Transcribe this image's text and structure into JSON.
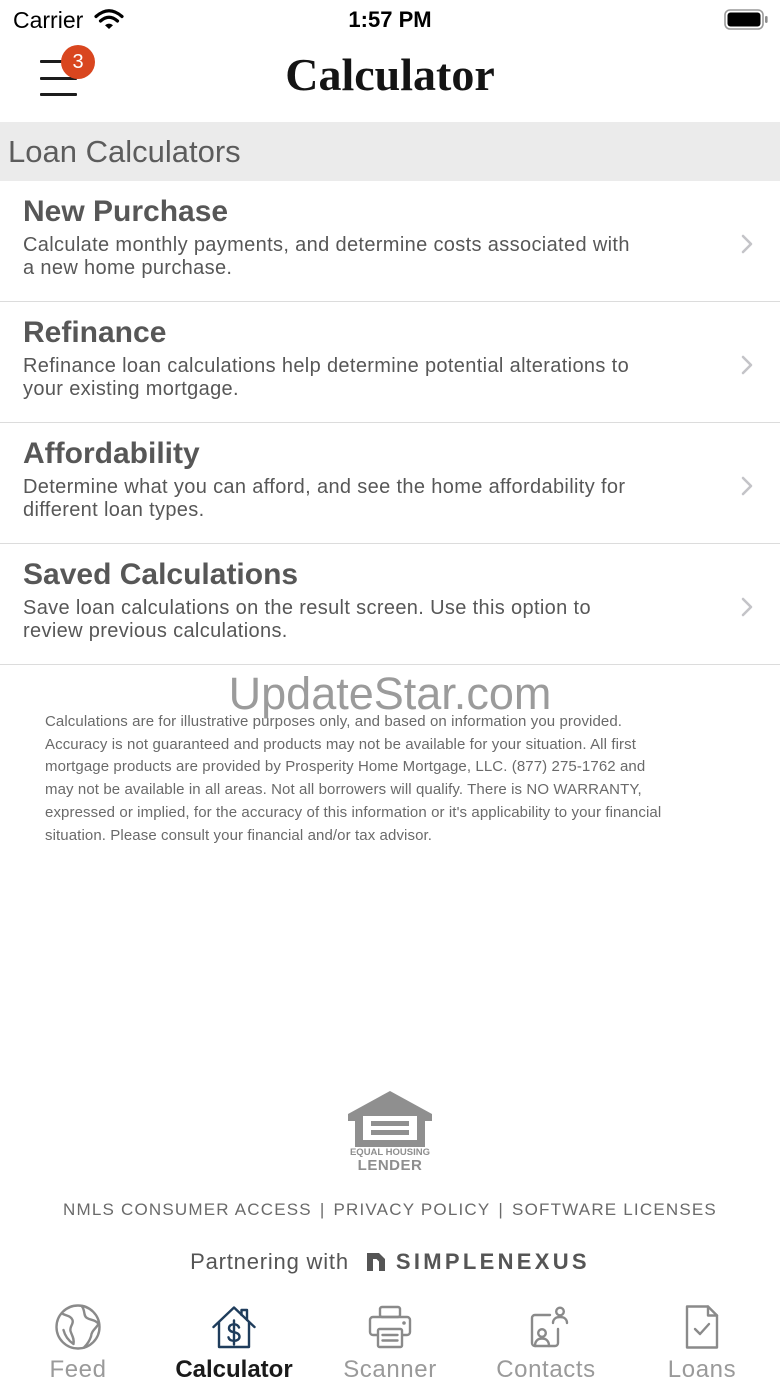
{
  "status_bar": {
    "carrier": "Carrier",
    "time": "1:57 PM",
    "icons": [
      "wifi-icon",
      "battery-icon"
    ]
  },
  "header": {
    "title": "Calculator",
    "menu_icon": "hamburger-menu-icon",
    "menu_badge": "3"
  },
  "section": {
    "title": "Loan Calculators"
  },
  "calculators": [
    {
      "title": "New Purchase",
      "description_lines": [
        "Calculate monthly payments, and determine costs associated with",
        "a new home purchase."
      ]
    },
    {
      "title": "Refinance",
      "description_lines": [
        "Refinance loan calculations help determine potential alterations to",
        "your existing mortgage."
      ]
    },
    {
      "title": "Affordability",
      "description_lines": [
        "Determine what you can afford, and see the home affordability for",
        "different loan types."
      ]
    },
    {
      "title": "Saved Calculations",
      "description_lines": [
        "Save loan calculations on the result screen. Use this option to",
        "review previous calculations."
      ]
    }
  ],
  "watermark": "UpdateStar.com",
  "disclaimer_lines": [
    "Calculations are for illustrative purposes only, and based on information you provided.",
    "Accuracy is not guaranteed and products may not be available for your situation. All first",
    "mortgage products are provided by Prosperity Home Mortgage, LLC. (877) 275-1762 and",
    "may not be available in all areas. Not all borrowers will qualify. There is NO WARRANTY,",
    "expressed or implied, for the accuracy of this information or it's applicability to your financial",
    "situation. Please consult your financial and/or tax advisor."
  ],
  "equal_housing_logo": {
    "line1": "EQUAL HOUSING",
    "line2": "LENDER"
  },
  "footer_links": [
    "NMLS CONSUMER ACCESS",
    "PRIVACY POLICY",
    "SOFTWARE LICENSES"
  ],
  "footer_separator": "|",
  "partner": {
    "prefix": "Partnering with",
    "brand": "SIMPLENEXUS"
  },
  "tabs": [
    {
      "label": "Feed",
      "icon": "globe-icon",
      "active": false
    },
    {
      "label": "Calculator",
      "icon": "house-dollar-icon",
      "active": true
    },
    {
      "label": "Scanner",
      "icon": "printer-icon",
      "active": false
    },
    {
      "label": "Contacts",
      "icon": "contacts-icon",
      "active": false
    },
    {
      "label": "Loans",
      "icon": "document-check-icon",
      "active": false
    }
  ],
  "colors": {
    "badge": "#d9461f",
    "active_tab_icon": "#1f3d5c",
    "section_bg": "#ebebeb",
    "text_primary": "#575757",
    "text_muted": "#8e8e8e"
  }
}
